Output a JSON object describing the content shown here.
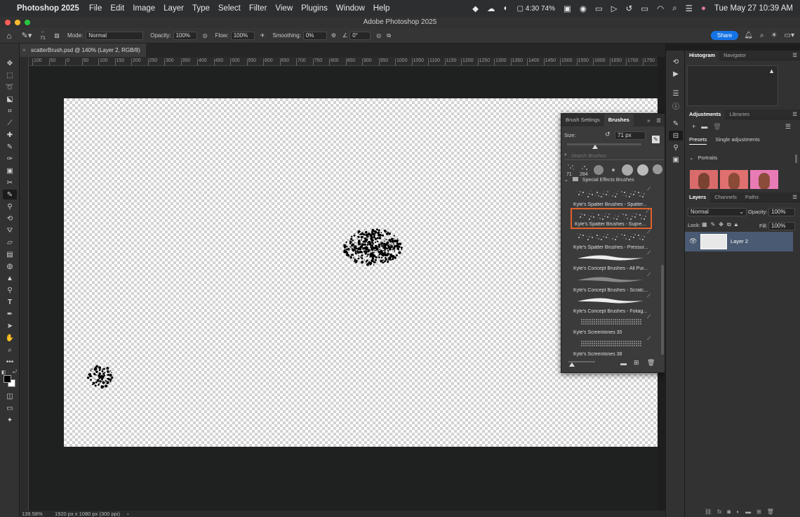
{
  "menubar": {
    "app_name": "Photoshop 2025",
    "items": [
      "File",
      "Edit",
      "Image",
      "Layer",
      "Type",
      "Select",
      "Filter",
      "View",
      "Plugins",
      "Window",
      "Help"
    ],
    "time_display": "4:30",
    "percent": "74%",
    "datetime": "Tue May 27  10:39 AM"
  },
  "window_title": "Adobe Photoshop 2025",
  "options": {
    "brush_size": "71",
    "mode_label": "Mode:",
    "mode_value": "Normal",
    "opacity_label": "Opacity:",
    "opacity_value": "100%",
    "flow_label": "Flow:",
    "flow_value": "100%",
    "smoothing_label": "Smoothing:",
    "smoothing_value": "0%",
    "angle_value": "0°",
    "share_label": "Share"
  },
  "document": {
    "tab_title": "scatterBrush.psd @ 140% (Layer 2, RGB/8)",
    "ruler_ticks": [
      "100",
      "50",
      "0",
      "50",
      "100",
      "150",
      "200",
      "250",
      "300",
      "350",
      "400",
      "450",
      "500",
      "550",
      "600",
      "650",
      "700",
      "750",
      "800",
      "850",
      "900",
      "950",
      "1000",
      "1050",
      "1100",
      "1150",
      "1200",
      "1250",
      "1300",
      "1350",
      "1400",
      "1450",
      "1500",
      "1550",
      "1600",
      "1650",
      "1700",
      "1750",
      "1800"
    ]
  },
  "status": {
    "zoom": "139.58%",
    "doc_info": "1920 px x 1080 px (300 ppi)",
    "arrow": "›"
  },
  "brush_panel": {
    "tabs": [
      "Brush Settings",
      "Brushes"
    ],
    "size_label": "Size:",
    "size_value": "71 px",
    "size_slider": 0.38,
    "search_placeholder": "Search Brushes",
    "recent_sizes": [
      "71",
      "284"
    ],
    "group_name": "Special Effects Brushes",
    "items": [
      "Kyle's Spatter Brushes - Spatter...",
      "Kyle's Spatter Brushes - Supre...",
      "Kyle's Spatter Brushes - Pressur...",
      "Kyle's Concept Brushes - All Pur...",
      "Kyle's Concept Brushes - Scratc...",
      "Kyle's Concept Brushes - Foliag...",
      "Kyle's Screentones 35",
      "Kyle's Screentones 38"
    ],
    "selected_index": 1
  },
  "right": {
    "histogram_tabs": [
      "Histogram",
      "Navigator"
    ],
    "adjust_tabs": [
      "Adjustments",
      "Libraries"
    ],
    "preset_tabs": [
      "Presets",
      "Single adjustments"
    ],
    "portraits_label": "Portraits",
    "layers_tabs": [
      "Layers",
      "Channels",
      "Paths"
    ],
    "blend_mode": "Normal",
    "opacity_label": "Opacity:",
    "opacity_value": "100%",
    "lock_label": "Lock:",
    "fill_label": "Fill:",
    "fill_value": "100%",
    "layer_name": "Layer 2"
  },
  "colors": {
    "accent": "#1473e6",
    "selection_outline": "#e0622a",
    "layer_selected": "#4a5a72"
  }
}
